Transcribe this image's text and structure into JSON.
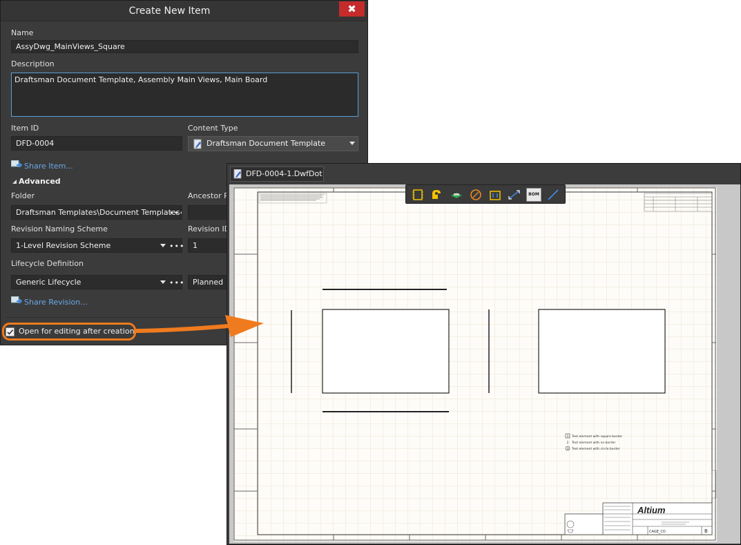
{
  "dialog": {
    "title": "Create New Item",
    "close_symbol": "✖",
    "name_label": "Name",
    "name_value": "AssyDwg_MainViews_Square",
    "description_label": "Description",
    "description_value": "Draftsman Document Template, Assembly Main Views, Main Board",
    "item_id_label": "Item ID",
    "item_id_value": "DFD-0004",
    "content_type_label": "Content Type",
    "content_type_value": "Draftsman Document Template",
    "share_item_link": "Share Item...",
    "advanced_header": "Advanced",
    "folder_label": "Folder",
    "folder_value": "Draftsman Templates\\Document Templates",
    "ancestor_label": "Ancestor R",
    "revision_naming_label": "Revision Naming Scheme",
    "revision_naming_value": "1-Level Revision Scheme",
    "revision_id_label": "Revision ID",
    "revision_id_value": "1",
    "lifecycle_label": "Lifecycle Definition",
    "lifecycle_value": "Generic Lifecycle",
    "lifecycle_state_value": "Planned",
    "share_revision_link": "Share Revision...",
    "open_for_editing_label": "Open for editing after creation",
    "open_for_editing_checked": true,
    "ellipsis": "•••"
  },
  "document": {
    "tab_label": "DFD-0004-1.DwfDot *",
    "toolbar_icons": [
      "board-assembly-view-icon",
      "board-fabrication-view-icon",
      "board-isometric-view-icon",
      "drill-table-icon",
      "layer-stack-icon",
      "dimension-icon",
      "bom-icon",
      "line-icon"
    ],
    "bom_label": "BOM",
    "title_block_brand": "Altium",
    "title_block_cage": "CAGE_CO",
    "title_block_size": "B",
    "notes": [
      "Text element with square border",
      "Text element with no border",
      "Text element with circle border"
    ],
    "note_markers": [
      "1",
      "2",
      "3"
    ],
    "border_column_marks": [
      "1",
      "2",
      "3",
      "4",
      "5",
      "6"
    ],
    "border_row_marks": [
      "A",
      "B",
      "C",
      "D",
      "E",
      "F"
    ]
  },
  "colors": {
    "dialog_bg": "#3b3b3b",
    "accent_orange": "#f07b1e",
    "link_blue": "#6aa8e8",
    "close_red": "#c42b2b",
    "focus_blue": "#5aa0d8",
    "grid_line": "#efe2cf"
  }
}
